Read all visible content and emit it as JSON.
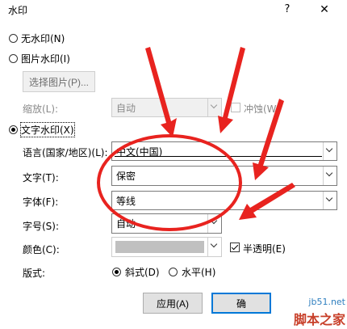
{
  "window": {
    "title": "水印",
    "help_icon": "?",
    "close_icon": "✕"
  },
  "options": {
    "none": {
      "label": "无水印(N)"
    },
    "picture": {
      "label": "图片水印(I)",
      "select_button": "选择图片(P)...",
      "scale_label": "缩放(L):",
      "scale_value": "自动",
      "washout_label": "冲蚀(W)"
    },
    "text": {
      "label": "文字水印(X)",
      "language_label": "语言(国家/地区)(L):",
      "language_value": "中文(中国)",
      "text_label": "文字(T):",
      "text_value": "保密",
      "font_label": "字体(F):",
      "font_value": "等线",
      "size_label": "字号(S):",
      "size_value": "自动",
      "color_label": "颜色(C):",
      "color_value": "#c0c0c0",
      "semitransparent_label": "半透明(E)",
      "layout_label": "版式:",
      "diagonal_label": "斜式(D)",
      "horizontal_label": "水平(H)"
    }
  },
  "footer": {
    "apply_button": "应用(A)",
    "ok_button": "确"
  },
  "watermark": {
    "line1": "jb51.net",
    "line2": "脚本之家"
  },
  "annotations": {
    "color": "#e8231f"
  }
}
